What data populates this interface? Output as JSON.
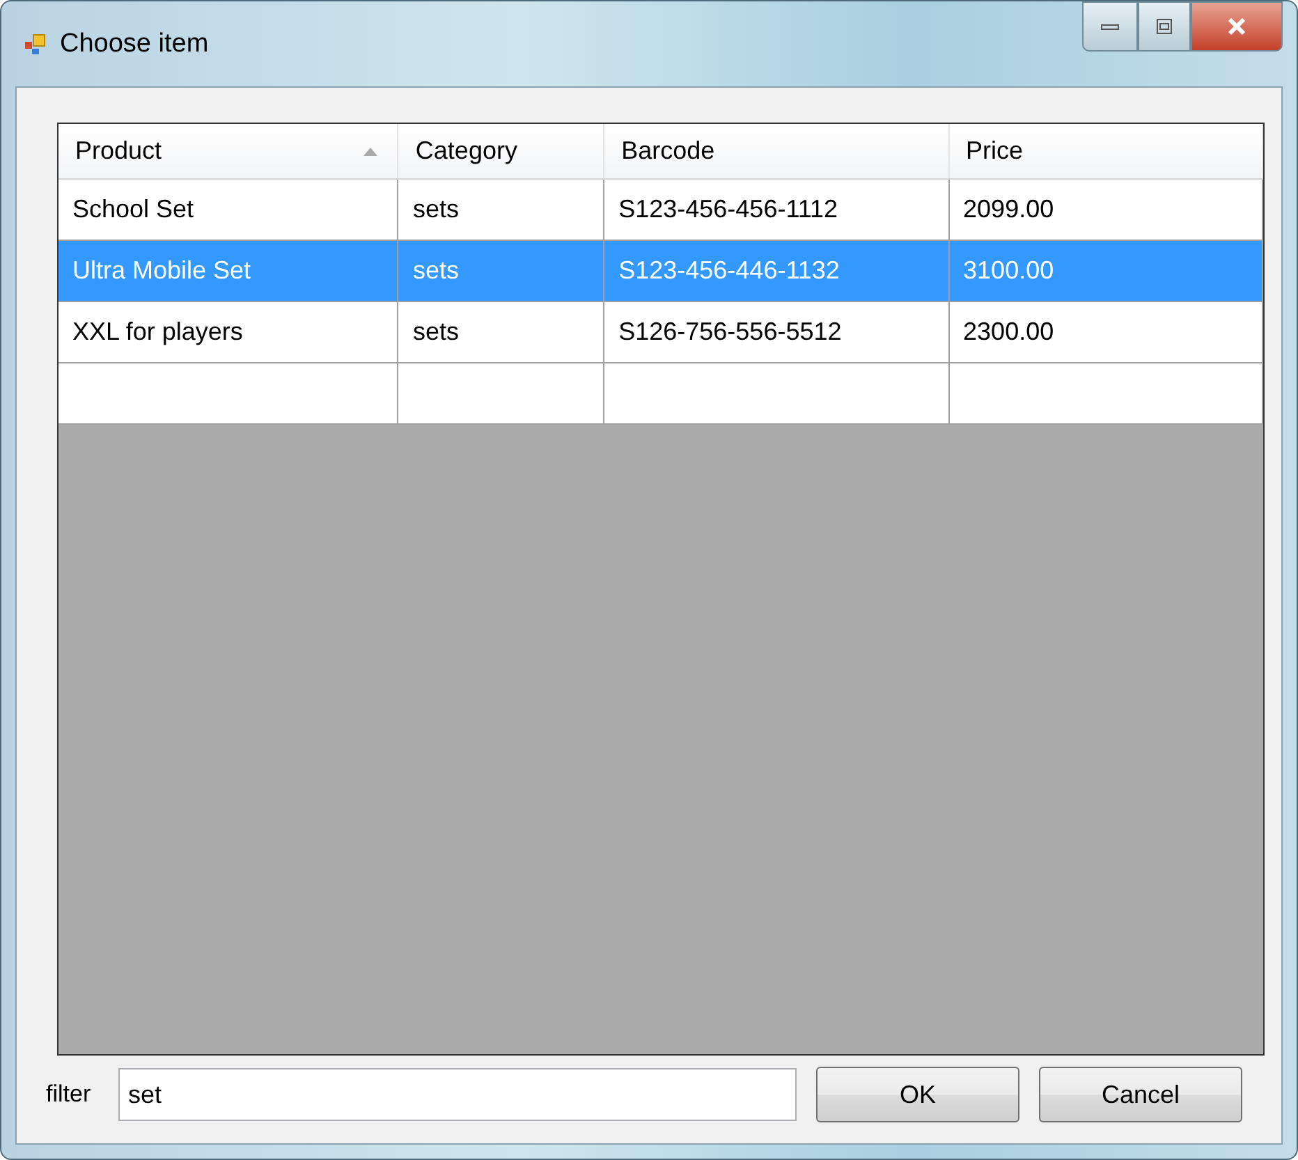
{
  "window": {
    "title": "Choose item"
  },
  "table": {
    "columns": [
      {
        "label": "Product",
        "sorted": true
      },
      {
        "label": "Category",
        "sorted": false
      },
      {
        "label": "Barcode",
        "sorted": false
      },
      {
        "label": "Price",
        "sorted": false
      }
    ],
    "rows": [
      {
        "cells": [
          "School Set",
          "sets",
          "S123-456-456-1112",
          "2099.00"
        ],
        "selected": false
      },
      {
        "cells": [
          "Ultra Mobile Set",
          "sets",
          "S123-456-446-1132",
          "3100.00"
        ],
        "selected": true
      },
      {
        "cells": [
          "XXL for players",
          "sets",
          "S126-756-556-5512",
          "2300.00"
        ],
        "selected": false
      }
    ]
  },
  "filter": {
    "label": "filter",
    "value": "set"
  },
  "buttons": [
    "OK",
    "Cancel"
  ]
}
